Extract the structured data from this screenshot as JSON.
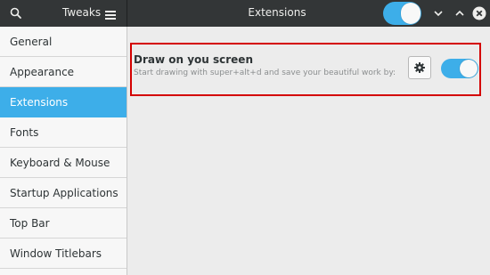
{
  "header": {
    "app_title": "Tweaks",
    "page_title": "Extensions",
    "global_toggle": {
      "on": true
    }
  },
  "sidebar": {
    "items": [
      {
        "label": "General"
      },
      {
        "label": "Appearance"
      },
      {
        "label": "Extensions",
        "selected": true
      },
      {
        "label": "Fonts"
      },
      {
        "label": "Keyboard & Mouse"
      },
      {
        "label": "Startup Applications"
      },
      {
        "label": "Top Bar"
      },
      {
        "label": "Window Titlebars"
      }
    ]
  },
  "extension": {
    "name": "Draw on you screen",
    "description": "Start drawing with super+alt+d and save your beautiful work by:",
    "enabled": true
  },
  "colors": {
    "accent": "#3daee9",
    "header_bg": "#333637",
    "highlight_border": "#d40000"
  },
  "icons": {
    "search": "search-icon",
    "menu": "hamburger-menu-icon",
    "chevron_down": "chevron-down-icon",
    "chevron_up": "chevron-up-icon",
    "close": "close-icon",
    "settings": "gear-icon"
  }
}
